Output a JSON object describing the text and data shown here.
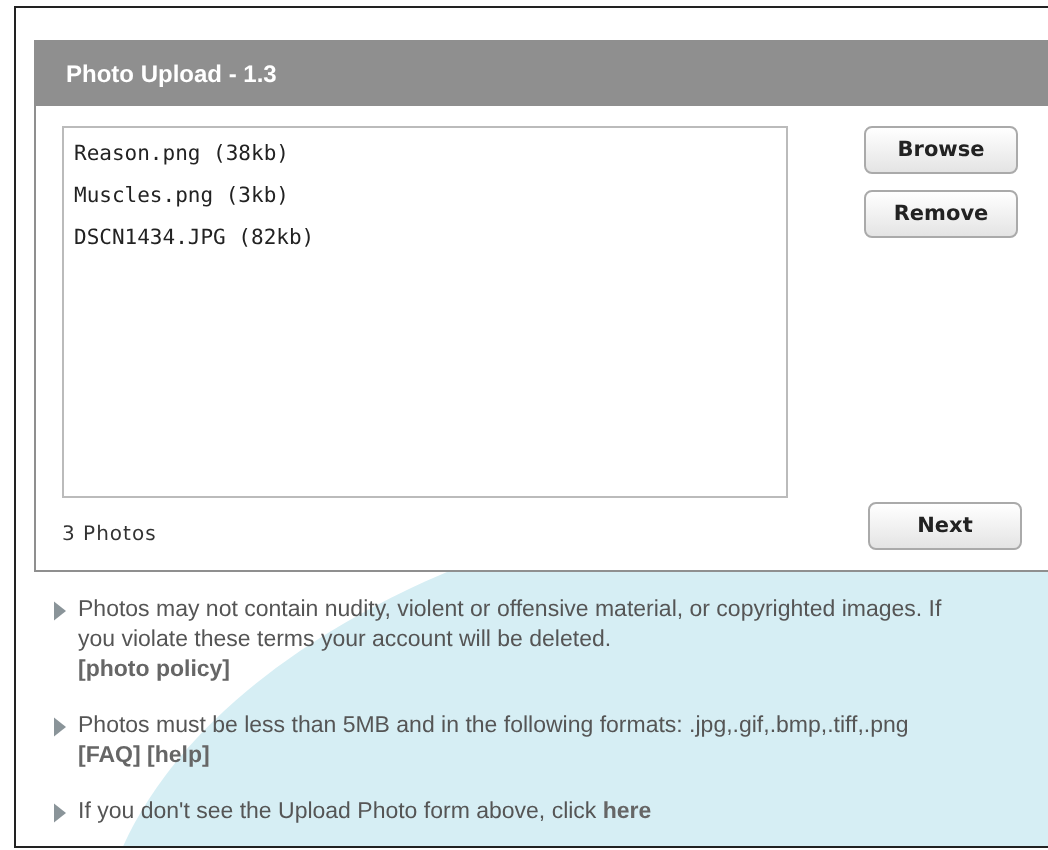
{
  "panel": {
    "title": "Photo Upload - 1.3",
    "files": [
      {
        "name": "Reason.png (38kb)",
        "selected": false
      },
      {
        "name": "Muscles.png (3kb)",
        "selected": false
      },
      {
        "name": "DSCN1434.JPG (82kb)",
        "selected": false
      }
    ],
    "buttons": [
      "Browse",
      "Remove"
    ],
    "count": "3 Photos",
    "next": "Next"
  },
  "notes": [
    {
      "text": "Photos may not contain nudity, violent or offensive material, or copyrighted images. If you violate these terms your account will be deleted.",
      "links": [
        "[photo policy]"
      ],
      "inline": false
    },
    {
      "text": "Photos must be less than 5MB and in the following formats:  .jpg,.gif,.bmp,.tiff,.png",
      "links": [
        "[FAQ]",
        "[help]"
      ],
      "inline": false
    },
    {
      "text": "If you don't see the Upload Photo form above, click",
      "links": [
        "here"
      ],
      "inline": true
    }
  ]
}
